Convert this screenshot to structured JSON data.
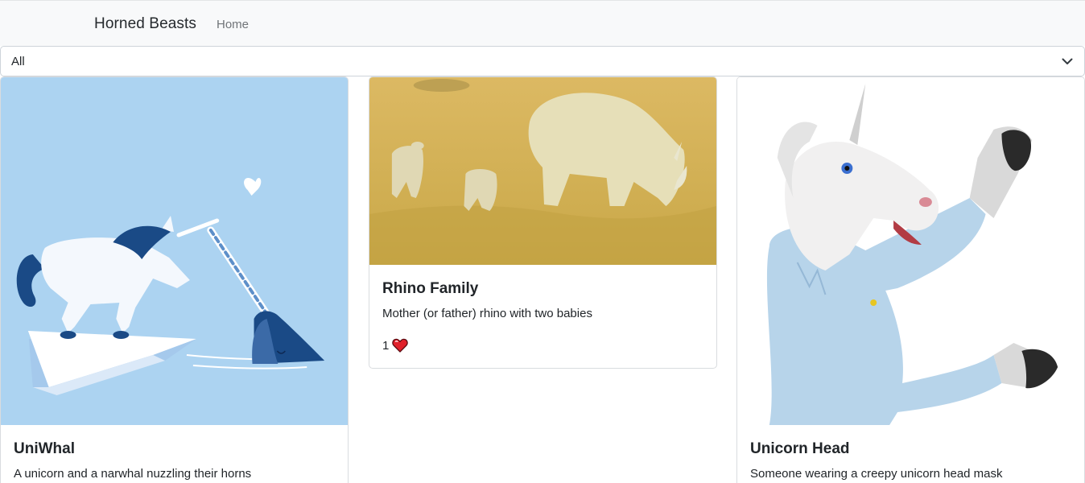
{
  "navbar": {
    "brand": "Horned Beasts",
    "home_link": "Home"
  },
  "filter": {
    "selected": "All"
  },
  "cards": [
    {
      "title": "UniWhal",
      "description": "A unicorn and a narwhal nuzzling their horns"
    },
    {
      "title": "Rhino Family",
      "description": "Mother (or father) rhino with two babies",
      "likes": "1"
    },
    {
      "title": "Unicorn Head",
      "description": "Someone wearing a creepy unicorn head mask"
    }
  ],
  "icons": {
    "filter_toggle": "chevron-down-icon",
    "like": "heart-icon"
  },
  "colors": {
    "navbar_bg": "#f8f9fa",
    "heart": "#e0202a",
    "uniwhal_bg": "#acd3f1"
  }
}
